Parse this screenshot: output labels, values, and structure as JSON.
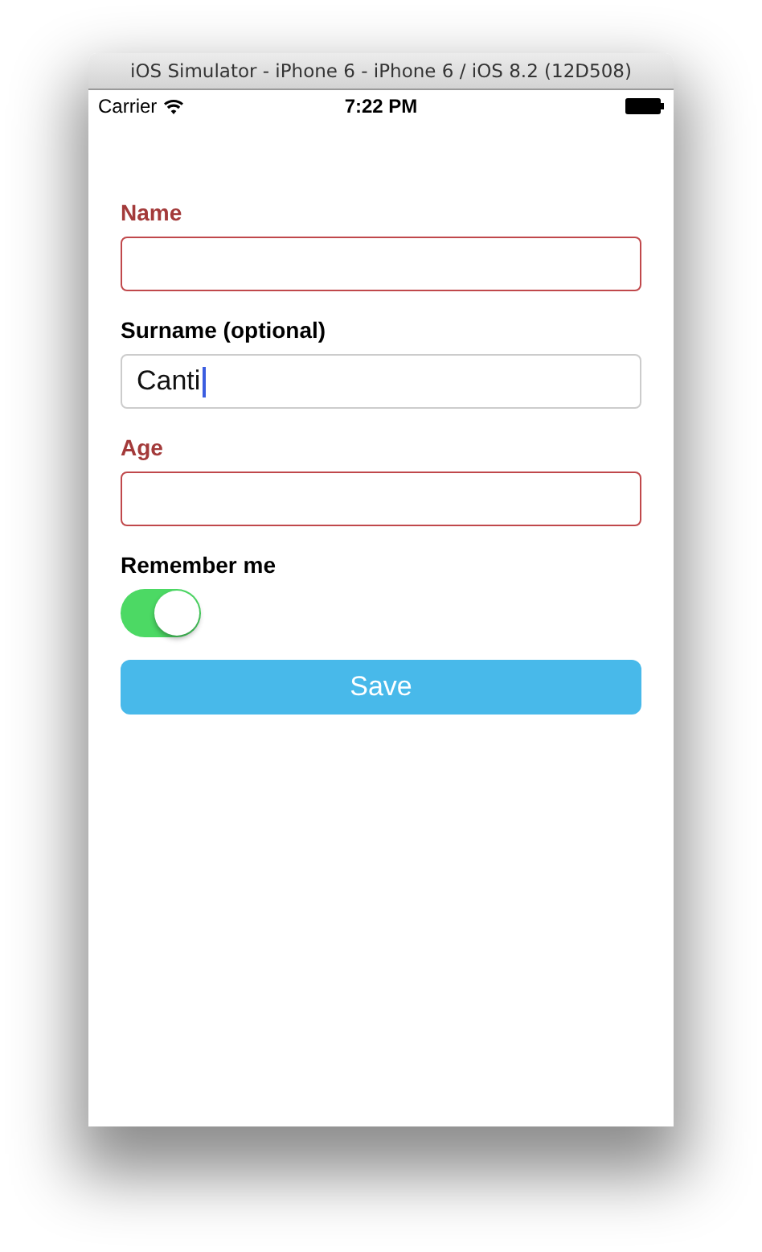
{
  "window": {
    "title": "iOS Simulator - iPhone 6 - iPhone 6 / iOS 8.2 (12D508)"
  },
  "status_bar": {
    "carrier": "Carrier",
    "time": "7:22 PM"
  },
  "fields": [
    {
      "label": "Name",
      "invalid": true,
      "focused": false
    },
    {
      "label": "Surname (optional)",
      "value": "Canti",
      "invalid": false,
      "focused": true
    },
    {
      "label": "Age",
      "invalid": true,
      "focused": false
    }
  ],
  "toggle": {
    "label": "Remember me",
    "on": true
  },
  "save_button": {
    "label": "Save"
  }
}
